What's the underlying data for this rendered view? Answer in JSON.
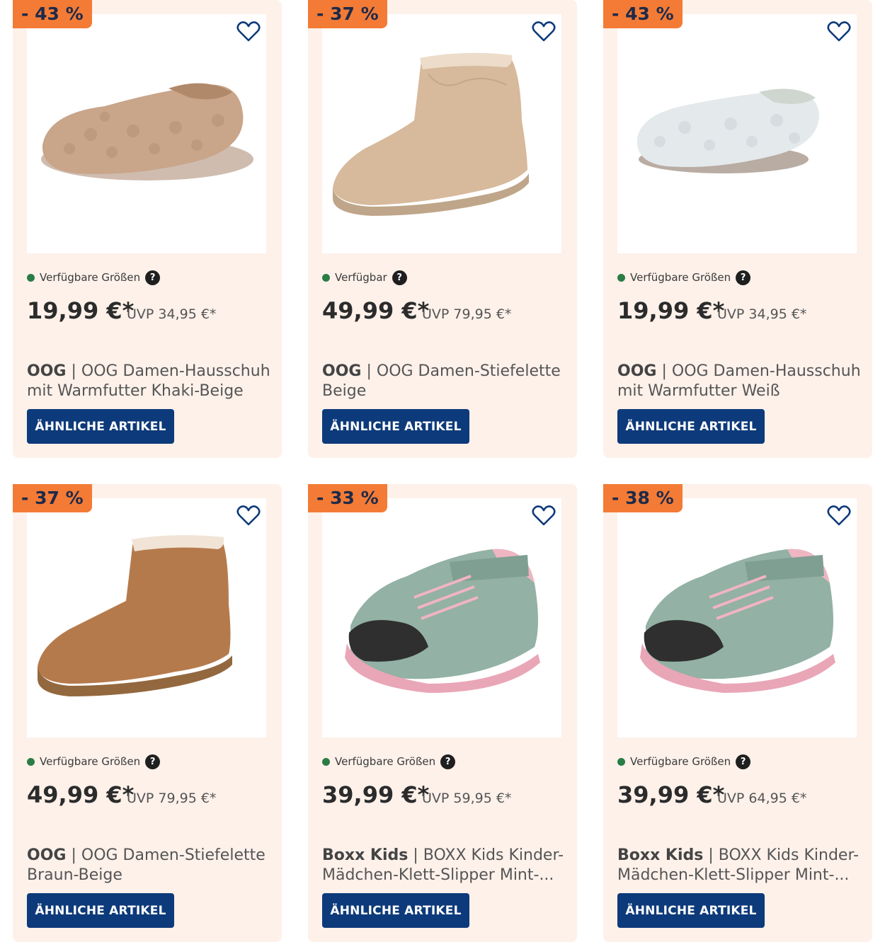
{
  "products": [
    {
      "discount": "- 43 %",
      "availability": "Verfügbare Größen",
      "price": "19,99 €*",
      "uvp": "UVP 34,95 €*",
      "brand": "OOG",
      "name_line1": "OOG Damen-Hausschuh",
      "name_line2": "mit Warmfutter Khaki-Beige",
      "button": "ÄHNLICHE ARTIKEL",
      "image_icon": "slipper-khaki-image",
      "color": "#c9a58a"
    },
    {
      "discount": "- 37 %",
      "availability": "Verfügbar",
      "price": "49,99 €*",
      "uvp": "UVP 79,95 €*",
      "brand": "OOG",
      "name_line1": "OOG Damen-Stiefelette",
      "name_line2": "Beige",
      "button": "ÄHNLICHE ARTIKEL",
      "image_icon": "boot-beige-image",
      "color": "#d7b99c"
    },
    {
      "discount": "- 43 %",
      "availability": "Verfügbare Größen",
      "price": "19,99 €*",
      "uvp": "UVP 34,95 €*",
      "brand": "OOG",
      "name_line1": "OOG Damen-Hausschuh",
      "name_line2": "mit Warmfutter Weiß",
      "button": "ÄHNLICHE ARTIKEL",
      "image_icon": "slipper-white-image",
      "color": "#e4e9ec"
    },
    {
      "discount": "- 37 %",
      "availability": "Verfügbare Größen",
      "price": "49,99 €*",
      "uvp": "UVP 79,95 €*",
      "brand": "OOG",
      "name_line1": "OOG Damen-Stiefelette",
      "name_line2": "Braun-Beige",
      "button": "ÄHNLICHE ARTIKEL",
      "image_icon": "boot-brown-image",
      "color": "#b57a4c"
    },
    {
      "discount": "- 33 %",
      "availability": "Verfügbare Größen",
      "price": "39,99 €*",
      "uvp": "UVP 59,95 €*",
      "brand": "Boxx Kids",
      "name_line1": "BOXX Kids Kinder-",
      "name_line2": "Mädchen-Klett-Slipper Mint-...",
      "button": "ÄHNLICHE ARTIKEL",
      "image_icon": "kids-sneaker-mint-image",
      "color": "#93b1a5"
    },
    {
      "discount": "- 38 %",
      "availability": "Verfügbare Größen",
      "price": "39,99 €*",
      "uvp": "UVP 64,95 €*",
      "brand": "Boxx Kids",
      "name_line1": "BOXX Kids Kinder-",
      "name_line2": "Mädchen-Klett-Slipper Mint-...",
      "button": "ÄHNLICHE ARTIKEL",
      "image_icon": "kids-sneaker-mint-image",
      "color": "#93b1a5"
    }
  ],
  "colors": {
    "card_bg": "#fdf1ea",
    "badge": "#f47b35",
    "button": "#0d3a7a",
    "available_dot": "#2a7d45"
  }
}
